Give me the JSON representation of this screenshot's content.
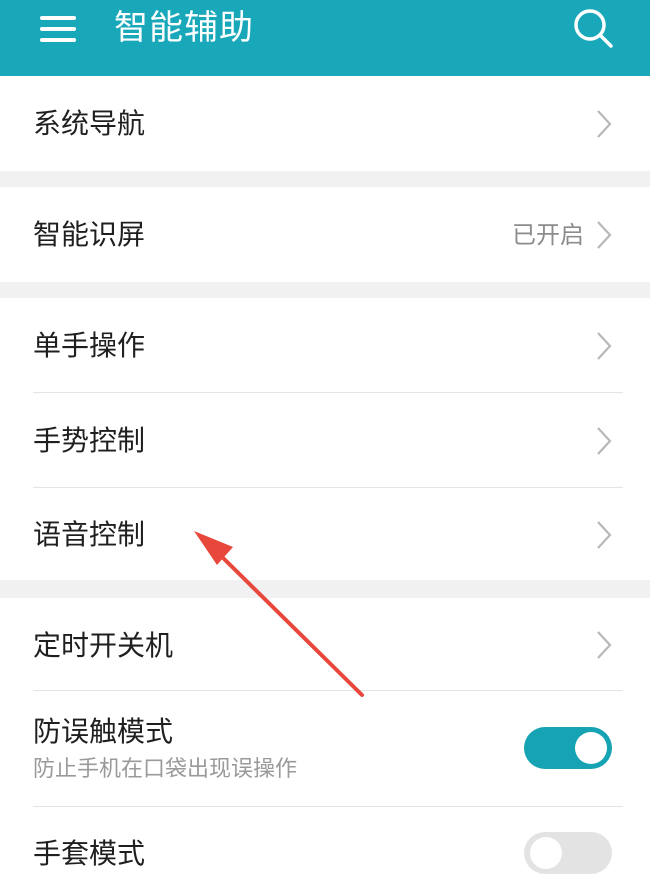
{
  "header": {
    "title": "智能辅助",
    "bg_color": "#18a8b9"
  },
  "groups": [
    {
      "rows": [
        {
          "label": "系统导航",
          "control": "chevron"
        }
      ]
    },
    {
      "rows": [
        {
          "label": "智能识屏",
          "value": "已开启",
          "control": "chevron"
        }
      ]
    },
    {
      "rows": [
        {
          "label": "单手操作",
          "control": "chevron"
        },
        {
          "label": "手势控制",
          "control": "chevron"
        },
        {
          "label": "语音控制",
          "control": "chevron"
        }
      ]
    },
    {
      "rows": [
        {
          "label": "定时开关机",
          "control": "chevron"
        },
        {
          "label": "防误触模式",
          "sublabel": "防止手机在口袋出现误操作",
          "control": "toggle",
          "toggle_state": "on"
        },
        {
          "label": "手套模式",
          "control": "toggle",
          "toggle_state": "off"
        }
      ]
    }
  ],
  "icons": {
    "menu": "hamburger-menu-icon",
    "search": "search-icon",
    "row_arrow": "chevron-right-icon"
  },
  "colors": {
    "accent": "#16a3b4",
    "annotation_arrow": "#e8483c"
  }
}
